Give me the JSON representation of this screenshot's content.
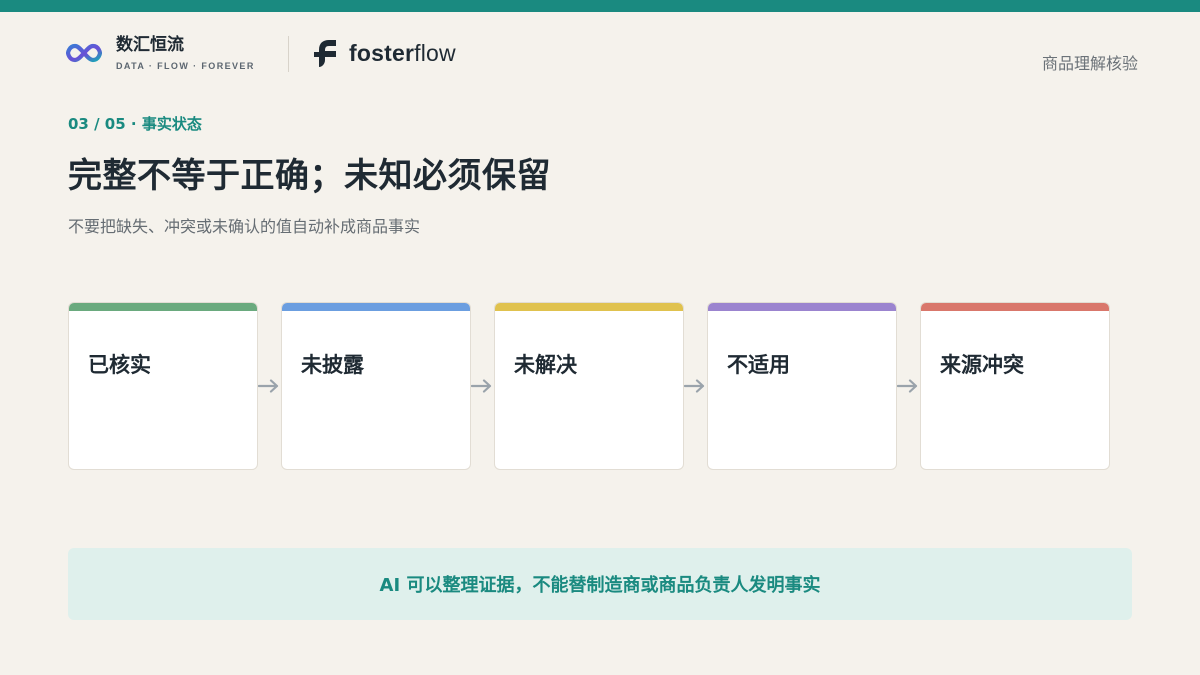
{
  "colors": {
    "accent": "#1a8a80",
    "background": "#f5f2ec",
    "callout_bg": "#dff0ec"
  },
  "header": {
    "brand": {
      "icon": "infinity-loop-logo-icon",
      "name": "数汇恒流",
      "tagline": "DATA · FLOW · FOREVER"
    },
    "partner": {
      "icon": "fosterflow-logo-icon",
      "name_bold": "foster",
      "name_light": "flow"
    },
    "page_context": "商品理解核验"
  },
  "section": {
    "label": "03 / 05 · 事实状态",
    "headline": "完整不等于正确；未知必须保留",
    "subhead": "不要把缺失、冲突或未确认的值自动补成商品事实"
  },
  "states": [
    {
      "label": "已核实",
      "color": "#6aaa7e"
    },
    {
      "label": "未披露",
      "color": "#6b9ee0"
    },
    {
      "label": "未解决",
      "color": "#e0c24e"
    },
    {
      "label": "不适用",
      "color": "#9b84cf"
    },
    {
      "label": "来源冲突",
      "color": "#d9776b"
    }
  ],
  "callout": {
    "text": "AI 可以整理证据，不能替制造商或商品负责人发明事实"
  }
}
